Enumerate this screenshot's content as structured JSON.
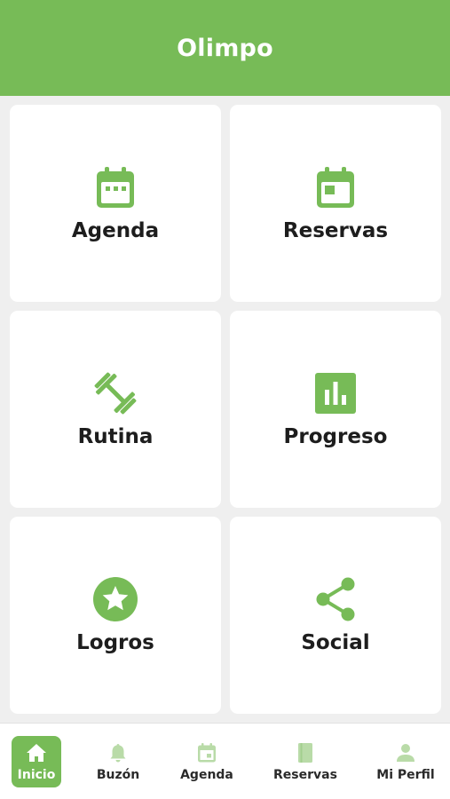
{
  "app": {
    "title": "Olimpo",
    "accent_color": "#77bb57",
    "icon_light_color": "#b9dba8"
  },
  "tiles": [
    {
      "label": "Agenda",
      "icon": "calendar-icon"
    },
    {
      "label": "Reservas",
      "icon": "calendar-event-icon"
    },
    {
      "label": "Rutina",
      "icon": "dumbbell-icon"
    },
    {
      "label": "Progreso",
      "icon": "bar-chart-icon"
    },
    {
      "label": "Logros",
      "icon": "star-badge-icon"
    },
    {
      "label": "Social",
      "icon": "share-icon"
    }
  ],
  "bottom_nav": [
    {
      "label": "Inicio",
      "icon": "home-icon",
      "active": true
    },
    {
      "label": "Buzón",
      "icon": "bell-icon",
      "active": false
    },
    {
      "label": "Agenda",
      "icon": "calendar-icon",
      "active": false
    },
    {
      "label": "Reservas",
      "icon": "book-icon",
      "active": false
    },
    {
      "label": "Mi Perfil",
      "icon": "user-icon",
      "active": false
    }
  ]
}
